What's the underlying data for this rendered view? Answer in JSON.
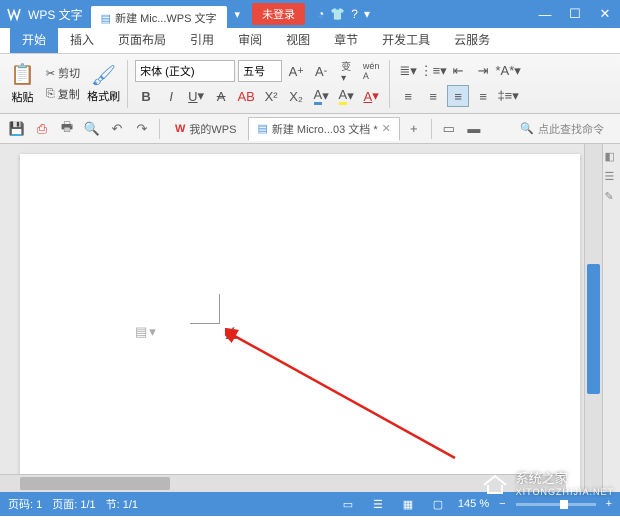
{
  "titlebar": {
    "app_name": "WPS 文字",
    "doc_title": "新建 Mic...WPS 文字",
    "login_label": "未登录"
  },
  "ribbon_tabs": [
    "开始",
    "插入",
    "页面布局",
    "引用",
    "审阅",
    "视图",
    "章节",
    "开发工具",
    "云服务"
  ],
  "clipboard": {
    "paste_label": "粘贴",
    "cut_label": "剪切",
    "copy_label": "复制",
    "painter_label": "格式刷"
  },
  "font": {
    "name": "宋体 (正文)",
    "size": "五号",
    "buttons": {
      "bold": "B",
      "italic": "I",
      "underline": "U",
      "strike": "A",
      "highlight": "AB",
      "super": "X²",
      "sub": "X₂",
      "fontcolor": "A",
      "bgcolor": "A",
      "clear": "A"
    }
  },
  "doc_tabs": {
    "wps_home": "我的WPS",
    "active_doc": "新建 Micro...03 文档 *",
    "add": "+"
  },
  "search_placeholder": "点此查找命令",
  "statusbar": {
    "page_label": "页码: 1",
    "page_of": "页面: 1/1",
    "section": "节: 1/1",
    "zoom": "145 %"
  },
  "watermark": {
    "title": "系统之家",
    "sub": "XITONGZHIJIA.NET"
  }
}
